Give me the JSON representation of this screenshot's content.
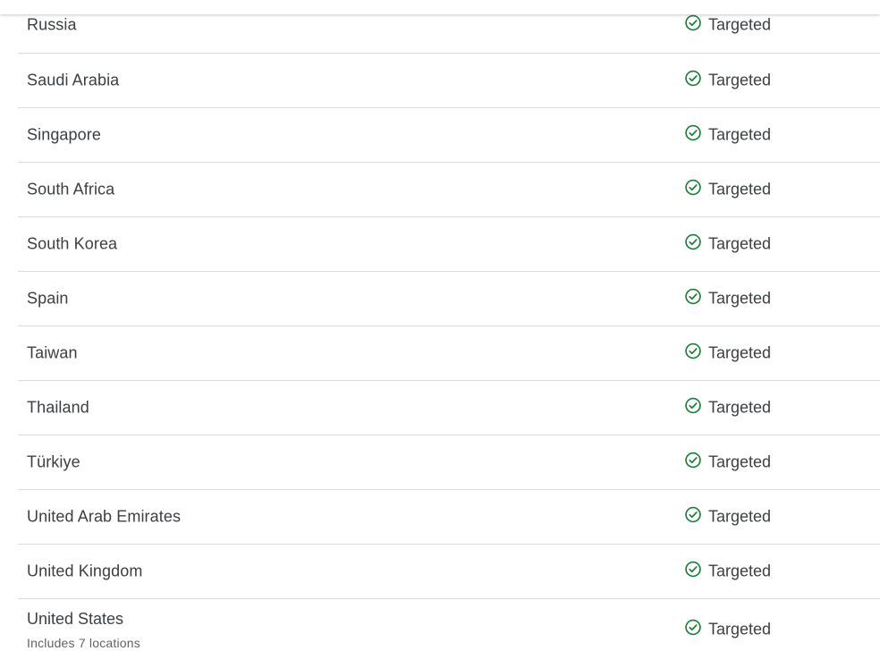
{
  "colors": {
    "check": "#188038",
    "text": "#3c4043",
    "subtext": "#5f6368",
    "divider": "#dadce0"
  },
  "status_icon": "check-circle-icon",
  "rows": [
    {
      "country": "Russia",
      "status": "Targeted"
    },
    {
      "country": "Saudi Arabia",
      "status": "Targeted"
    },
    {
      "country": "Singapore",
      "status": "Targeted"
    },
    {
      "country": "South Africa",
      "status": "Targeted"
    },
    {
      "country": "South Korea",
      "status": "Targeted"
    },
    {
      "country": "Spain",
      "status": "Targeted"
    },
    {
      "country": "Taiwan",
      "status": "Targeted"
    },
    {
      "country": "Thailand",
      "status": "Targeted"
    },
    {
      "country": "Türkiye",
      "status": "Targeted"
    },
    {
      "country": "United Arab Emirates",
      "status": "Targeted"
    },
    {
      "country": "United Kingdom",
      "status": "Targeted"
    },
    {
      "country": "United States",
      "subtitle": "Includes 7 locations",
      "status": "Targeted"
    }
  ]
}
